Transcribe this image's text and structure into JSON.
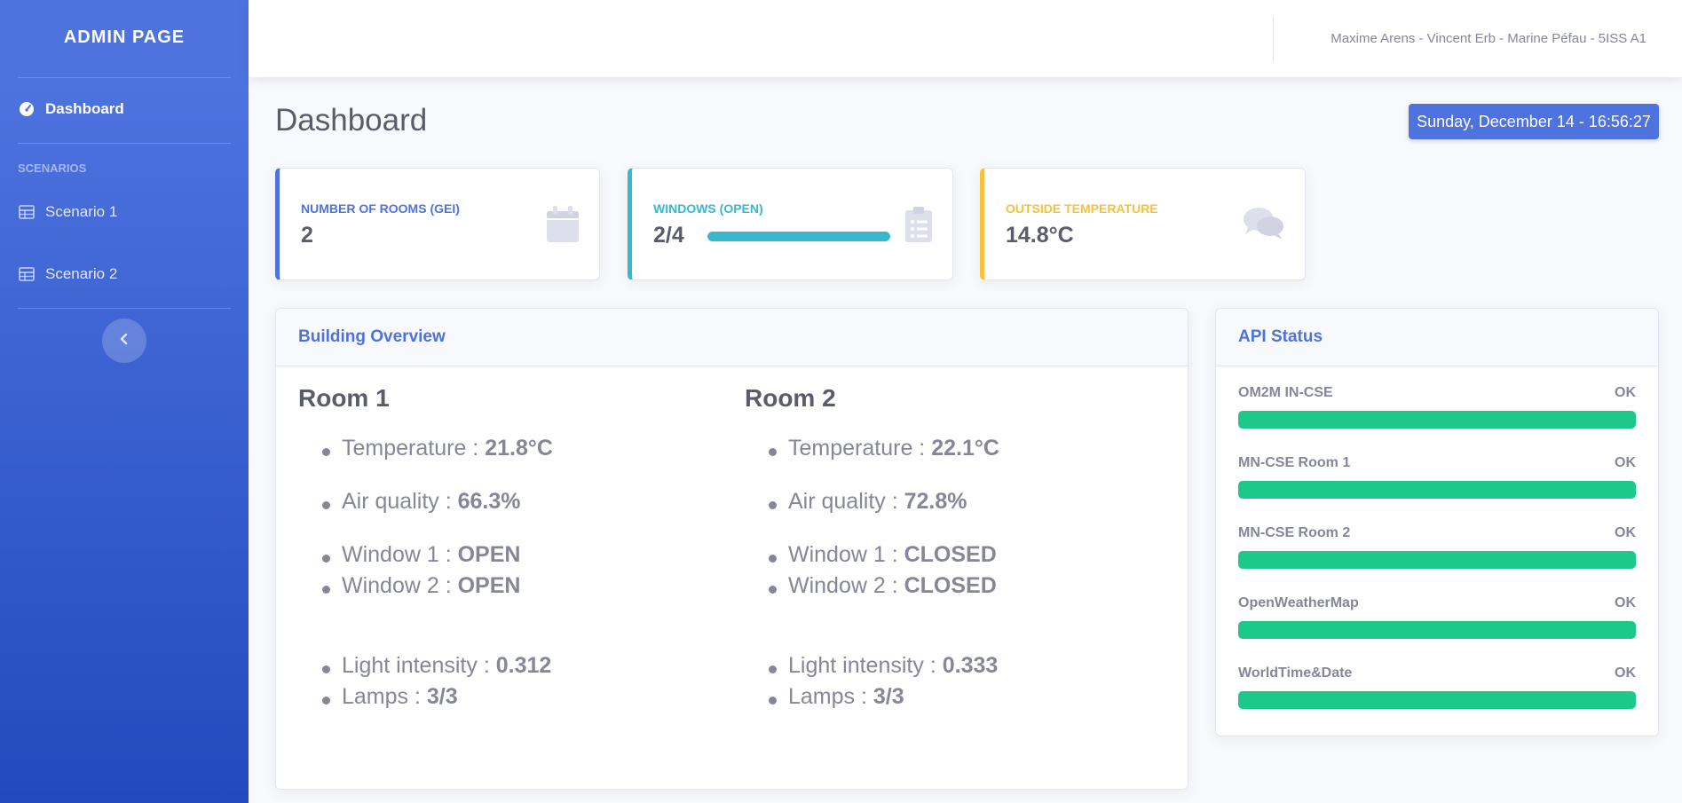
{
  "sidebar": {
    "brand": "ADMIN PAGE",
    "items": [
      {
        "label": "Dashboard",
        "icon": "tachometer-icon"
      },
      {
        "label": "Scenario 1",
        "icon": "table-icon"
      },
      {
        "label": "Scenario 2",
        "icon": "table-icon"
      }
    ],
    "section_heading": "SCENARIOS",
    "toggle_icon": "chevron-left-icon"
  },
  "topbar": {
    "authors": "Maxime Arens - Vincent Erb - Marine Péfau - 5ISS A1"
  },
  "page": {
    "title": "Dashboard",
    "datetime": "Sunday, December 14 - 16:56:27"
  },
  "stats": [
    {
      "label": "NUMBER OF ROOMS (GEI)",
      "value": "2",
      "icon": "calendar-icon",
      "color": "#4e73df"
    },
    {
      "label": "WINDOWS (OPEN)",
      "value": "2/4",
      "icon": "clipboard-list-icon",
      "color": "#36b9cc",
      "progress": 1.0
    },
    {
      "label": "OUTSIDE TEMPERATURE",
      "value": "14.8°C",
      "icon": "comments-icon",
      "color": "#f6c23e"
    }
  ],
  "building": {
    "title": "Building Overview",
    "rooms": [
      {
        "name": "Room 1",
        "temperature_label": "Temperature : ",
        "temperature": "21.8°C",
        "air_label": "Air quality : ",
        "air": "66.3%",
        "window1_label": "Window 1 : ",
        "window1": "OPEN",
        "window2_label": "Window 2 : ",
        "window2": "OPEN",
        "light_label": "Light intensity : ",
        "light": "0.312",
        "lamps_label": "Lamps : ",
        "lamps": "3/3"
      },
      {
        "name": "Room 2",
        "temperature_label": "Temperature : ",
        "temperature": "22.1°C",
        "air_label": "Air quality : ",
        "air": "72.8%",
        "window1_label": "Window 1 : ",
        "window1": "CLOSED",
        "window2_label": "Window 2 : ",
        "window2": "CLOSED",
        "light_label": "Light intensity : ",
        "light": "0.333",
        "lamps_label": "Lamps : ",
        "lamps": "3/3"
      }
    ]
  },
  "api": {
    "title": "API Status",
    "services": [
      {
        "name": "OM2M IN-CSE",
        "status": "OK",
        "progress": 1.0
      },
      {
        "name": "MN-CSE Room 1",
        "status": "OK",
        "progress": 1.0
      },
      {
        "name": "MN-CSE Room 2",
        "status": "OK",
        "progress": 1.0
      },
      {
        "name": "OpenWeatherMap",
        "status": "OK",
        "progress": 1.0
      },
      {
        "name": "WorldTime&Date",
        "status": "OK",
        "progress": 1.0
      }
    ],
    "ok_color": "#1cc88a"
  }
}
